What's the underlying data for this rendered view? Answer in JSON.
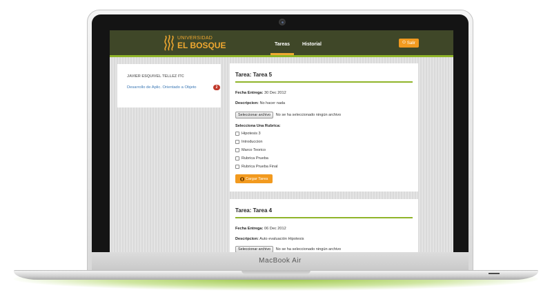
{
  "device": {
    "label": "MacBook Air"
  },
  "header": {
    "logo": {
      "line1": "UNIVERSIDAD",
      "line2": "EL BOSQUE"
    },
    "nav": [
      {
        "label": "Tareas",
        "active": true
      },
      {
        "label": "Historial",
        "active": false
      }
    ],
    "exit_label": "Salir",
    "colors": {
      "bar": "#3f4728",
      "stripe": "#8fb428",
      "accent": "#f29a1f"
    }
  },
  "sidebar": {
    "user_name": "JAVIER ESQUIVEL TELLEZ ITC",
    "course": {
      "label": "Desarrollo de Aplic. Orientado a Objeto",
      "count": "2"
    }
  },
  "tasks": [
    {
      "title": "Tarea: Tarea 5",
      "due_label": "Fecha Entrega:",
      "due_value": "30 Dec 2012",
      "desc_label": "Descripcion:",
      "desc_value": "No hacer nada",
      "file_button": "Seleccionar archivo",
      "file_status": "No se ha seleccionado ningún archivo",
      "rubric_label": "Selecciona Una Rubrica:",
      "rubrics": [
        "Hipotesis 3",
        "Introduccion",
        "Marco Teorico",
        "Rubrica Prueba",
        "Rubrica Prueba Final"
      ],
      "upload_button": "Cargar Tarea"
    },
    {
      "title": "Tarea: Tarea 4",
      "due_label": "Fecha Entrega:",
      "due_value": "06 Dec 2012",
      "desc_label": "Descripcion:",
      "desc_value": "Auto evaluación Hipotesis",
      "file_button": "Seleccionar archivo",
      "file_status": "No se ha seleccionado ningún archivo"
    }
  ]
}
